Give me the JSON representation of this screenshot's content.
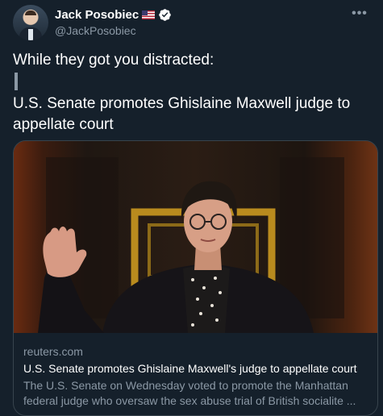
{
  "author": {
    "name": "Jack Posobiec",
    "handle": "@JackPosobiec",
    "flag_icon": "us-flag-icon",
    "verified_icon": "verified-badge-icon"
  },
  "tweet": {
    "line1": "While they got you distracted:",
    "line2": "U.S. Senate promotes Ghislaine Maxwell judge to appellate court"
  },
  "card": {
    "domain": "reuters.com",
    "title": "U.S. Senate promotes Ghislaine Maxwell's judge to appellate court",
    "description": "The U.S. Senate on Wednesday voted to promote the Manhattan federal judge who oversaw the sex abuse trial of British socialite ..."
  },
  "colors": {
    "background": "#15202b",
    "secondary_text": "#8b98a5",
    "verified": "#ffffff",
    "border": "#38444d"
  }
}
